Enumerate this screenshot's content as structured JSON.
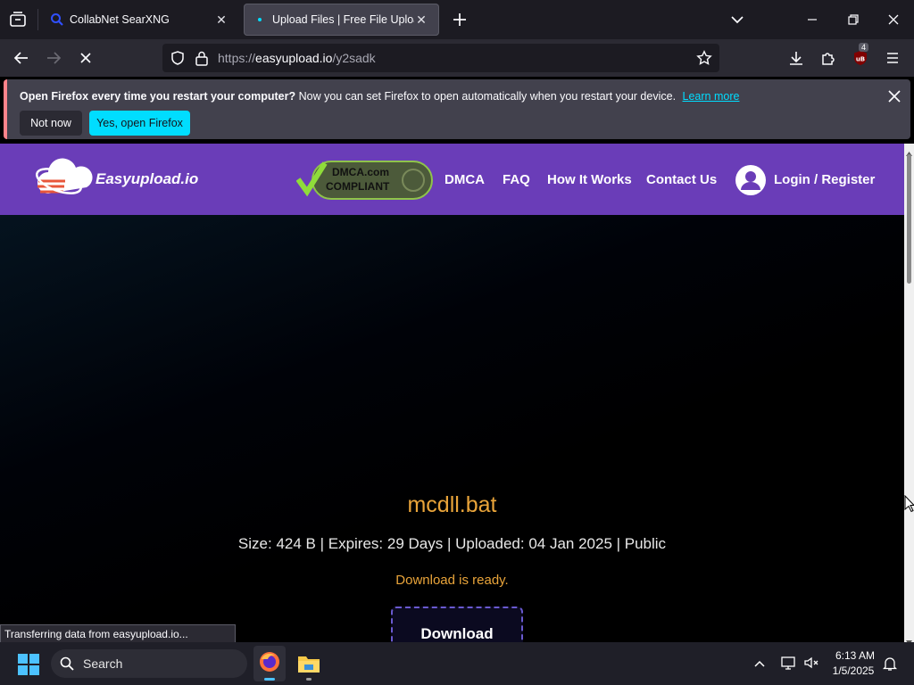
{
  "browser": {
    "tabs": [
      {
        "label": "CollabNet SearXNG"
      },
      {
        "label": "Upload Files | Free File Upload a"
      }
    ],
    "url": {
      "prefix": "https://",
      "host": "easyupload.io",
      "path": "/y2sadk"
    },
    "extension_badge": "4"
  },
  "notification": {
    "bold_text": "Open Firefox every time you restart your computer?",
    "text": "Now you can set Firefox to open automatically when you restart your device.",
    "link": "Learn more",
    "secondary_button": "Not now",
    "primary_button": "Yes, open Firefox"
  },
  "site": {
    "logo": "Easyupload.io",
    "badge_lines": [
      "DMCA.com",
      "COMPLIANT"
    ],
    "menu": [
      "DMCA",
      "FAQ",
      "How It Works",
      "Contact Us"
    ],
    "login": "Login / Register",
    "accent": "#6a3db8"
  },
  "file": {
    "name": "mcdll.bat",
    "meta": "Size: 424 B | Expires: 29 Days | Uploaded: 04 Jan 2025 | Public",
    "status": "Download is ready.",
    "button": "Download"
  },
  "status_bar": "Transferring data from easyupload.io...",
  "taskbar": {
    "search": "Search",
    "time": "6:13 AM",
    "date": "1/5/2025"
  }
}
